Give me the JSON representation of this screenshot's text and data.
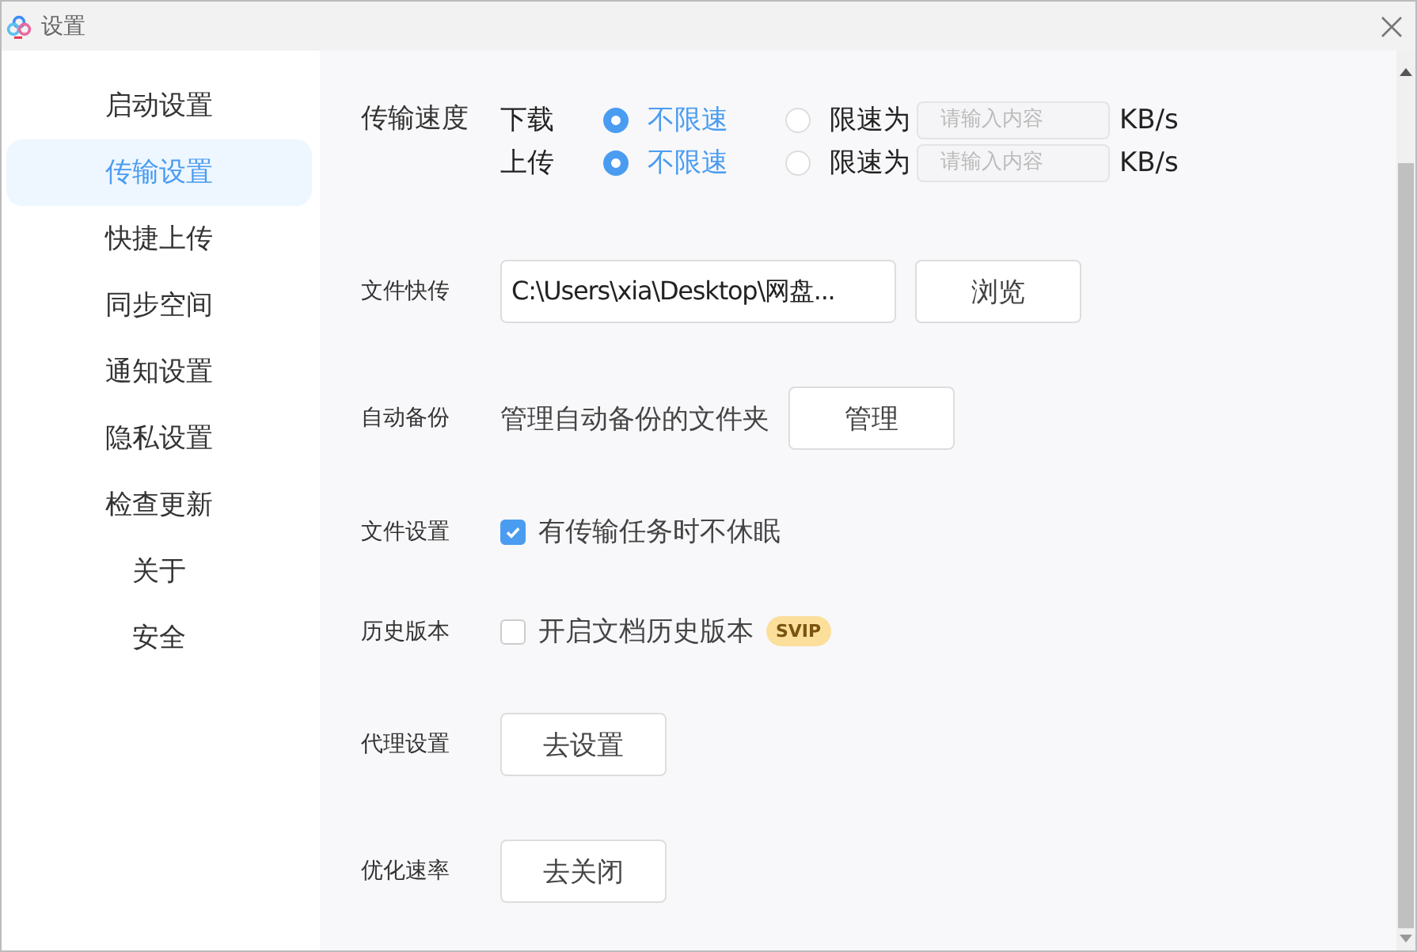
{
  "window": {
    "title": "设置"
  },
  "sidebar": {
    "items": [
      {
        "label": "启动设置",
        "selected": false
      },
      {
        "label": "传输设置",
        "selected": true
      },
      {
        "label": "快捷上传",
        "selected": false
      },
      {
        "label": "同步空间",
        "selected": false
      },
      {
        "label": "通知设置",
        "selected": false
      },
      {
        "label": "隐私设置",
        "selected": false
      },
      {
        "label": "检查更新",
        "selected": false
      },
      {
        "label": "关于",
        "selected": false
      },
      {
        "label": "安全",
        "selected": false
      }
    ]
  },
  "settings": [
    {
      "kind": "speed",
      "label": "传输速度",
      "lines": [
        {
          "direction": "下载",
          "options": [
            {
              "label": "不限速",
              "selected": true
            },
            {
              "label": "限速为",
              "selected": false
            }
          ],
          "placeholder": "请输入内容",
          "unit": "KB/s"
        },
        {
          "direction": "上传",
          "options": [
            {
              "label": "不限速",
              "selected": true
            },
            {
              "label": "限速为",
              "selected": false
            }
          ],
          "placeholder": "请输入内容",
          "unit": "KB/s"
        }
      ]
    },
    {
      "kind": "path",
      "label": "文件快传",
      "value": "C:\\Users\\xia\\Desktop\\网盘...",
      "button": "浏览"
    },
    {
      "kind": "manage",
      "label": "自动备份",
      "text": "管理自动备份的文件夹",
      "button": "管理"
    },
    {
      "kind": "checkbox",
      "label": "文件设置",
      "text": "有传输任务时不休眠",
      "checked": true
    },
    {
      "kind": "checkbox",
      "label": "历史版本",
      "text": "开启文档历史版本",
      "checked": false,
      "badge": "SVIP"
    },
    {
      "kind": "button",
      "label": "代理设置",
      "button": "去设置"
    },
    {
      "kind": "button",
      "label": "优化速率",
      "button": "去关闭"
    }
  ]
}
